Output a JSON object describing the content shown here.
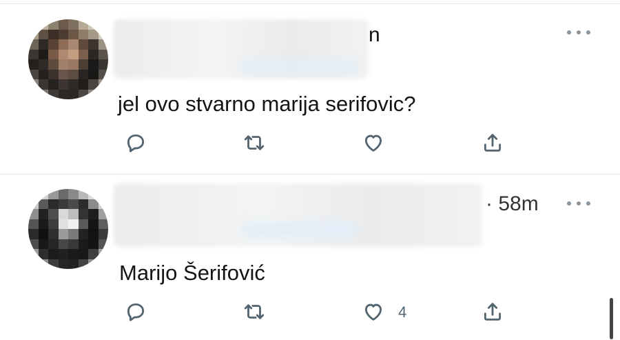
{
  "tweets": [
    {
      "name_tail": "n",
      "timestamp": "",
      "text": "jel ovo stvarno marija serifovic?",
      "like_count": "",
      "icons": {
        "reply": "reply-bubble-icon",
        "retweet": "retweet-icon",
        "like": "heart-icon",
        "share": "share-upload-icon",
        "more": "more-dots-icon"
      }
    },
    {
      "name_tail": "",
      "timestamp": "· 58m",
      "text": "Marijo Šerifović",
      "like_count": "4",
      "icons": {
        "reply": "reply-bubble-icon",
        "retweet": "retweet-icon",
        "like": "heart-icon",
        "share": "share-upload-icon",
        "more": "more-dots-icon"
      }
    }
  ],
  "colors": {
    "icon_gray": "#536471",
    "divider": "#e6e9eb",
    "text": "#141414"
  }
}
